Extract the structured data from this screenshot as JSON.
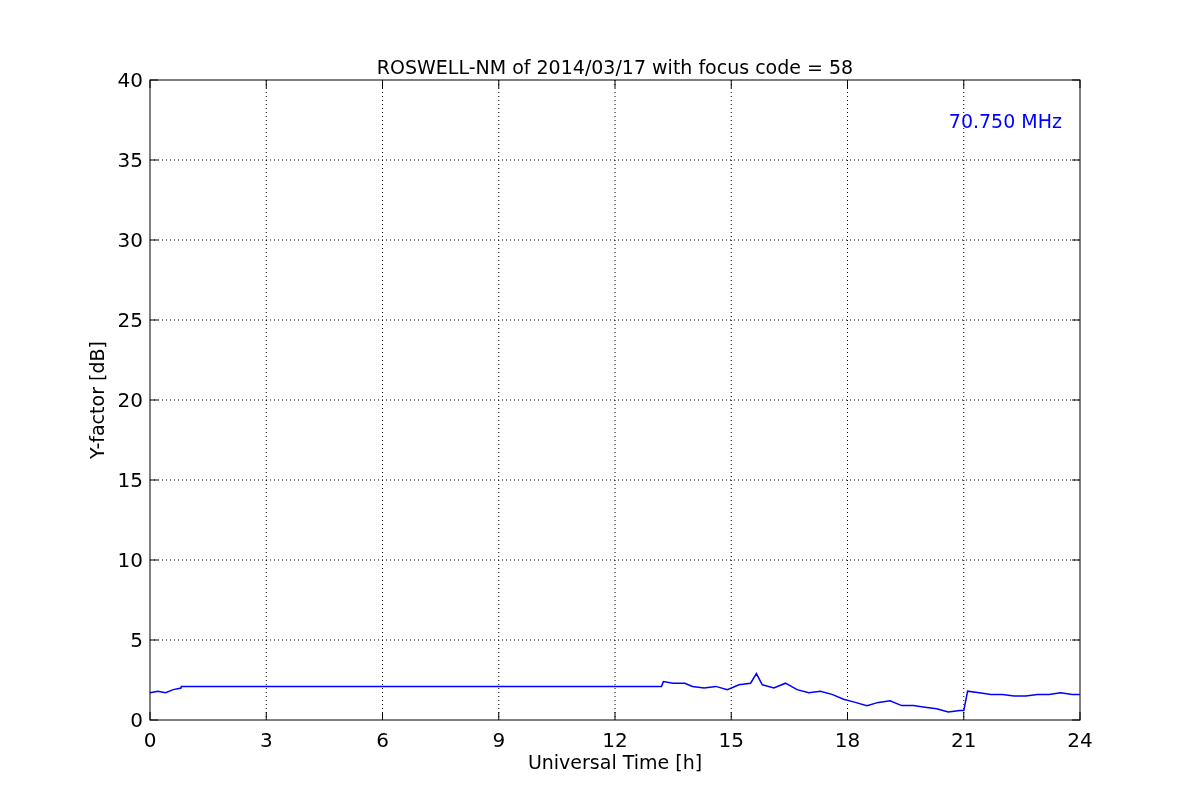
{
  "figure": {
    "chart_data": {
      "type": "line",
      "title": "ROSWELL-NM of 2014/03/17 with focus code = 58",
      "xlabel": "Universal Time [h]",
      "ylabel": "Y-factor [dB]",
      "xlim": [
        0,
        24
      ],
      "ylim": [
        0,
        40
      ],
      "xticks": [
        0,
        3,
        6,
        9,
        12,
        15,
        18,
        21,
        24
      ],
      "yticks": [
        0,
        5,
        10,
        15,
        20,
        25,
        30,
        35,
        40
      ],
      "x": [
        0,
        0.2,
        0.4,
        0.6,
        0.8,
        0.81,
        13.2,
        13.25,
        13.5,
        13.8,
        14.0,
        14.3,
        14.6,
        14.9,
        15.2,
        15.5,
        15.65,
        15.8,
        16.1,
        16.4,
        16.7,
        17.0,
        17.3,
        17.6,
        17.9,
        18.2,
        18.5,
        18.8,
        19.1,
        19.4,
        19.7,
        20.0,
        20.3,
        20.6,
        20.9,
        21.0,
        21.1,
        21.4,
        21.7,
        22.0,
        22.3,
        22.6,
        22.9,
        23.2,
        23.5,
        23.8,
        24
      ],
      "series": [
        {
          "color": "#0000ff",
          "values": [
            1.7,
            1.8,
            1.7,
            1.9,
            2.0,
            2.1,
            2.1,
            2.4,
            2.3,
            2.3,
            2.1,
            2.0,
            2.1,
            1.9,
            2.2,
            2.3,
            2.9,
            2.2,
            2.0,
            2.3,
            1.9,
            1.7,
            1.8,
            1.6,
            1.3,
            1.1,
            0.9,
            1.1,
            1.2,
            0.9,
            0.9,
            0.8,
            0.7,
            0.5,
            0.6,
            0.6,
            1.8,
            1.7,
            1.6,
            1.6,
            1.5,
            1.5,
            1.6,
            1.6,
            1.7,
            1.6,
            1.6
          ]
        }
      ],
      "grid": true,
      "annotations": [
        "70.750 MHz"
      ]
    }
  }
}
